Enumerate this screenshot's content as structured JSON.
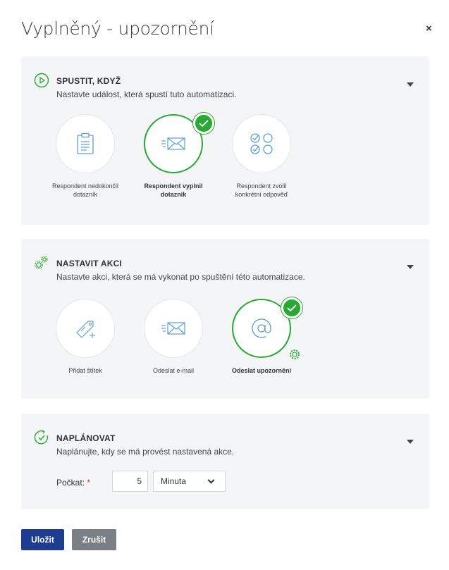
{
  "dialog": {
    "title": "Vyplněný - upozornění",
    "close": "×"
  },
  "trigger": {
    "title": "SPUSTIT, KDYŽ",
    "description": "Nastavte událost, která spustí tuto automatizaci.",
    "options": [
      {
        "label": "Respondent nedokončil dotazník",
        "icon": "clipboard-icon",
        "selected": false
      },
      {
        "label": "Respondent vyplnil dotazník",
        "icon": "envelope-send-icon",
        "selected": true
      },
      {
        "label": "Respondent zvolil konkrétní odpověď",
        "icon": "choice-options-icon",
        "selected": false
      }
    ]
  },
  "action": {
    "title": "NASTAVIT AKCI",
    "description": "Nastavte akci, která se má vykonat po spuštění této automatizace.",
    "options": [
      {
        "label": "Přidat štítek",
        "icon": "tag-add-icon",
        "selected": false
      },
      {
        "label": "Odeslat e-mail",
        "icon": "envelope-send-icon",
        "selected": false
      },
      {
        "label": "Odeslat upozornění",
        "icon": "at-sign-icon",
        "selected": true
      }
    ]
  },
  "schedule": {
    "title": "NAPLÁNOVAT",
    "description": "Naplánujte, kdy se má provést nastavená akce.",
    "wait_label": "Počkat:",
    "required_mark": "*",
    "wait_value": "5",
    "unit_selected": "Minuta"
  },
  "buttons": {
    "save": "Uložit",
    "cancel": "Zrušit"
  },
  "colors": {
    "accent_green": "#2aa836",
    "primary_blue": "#1d3c8f",
    "secondary_gray": "#7a7f85",
    "icon_blue": "#5a9fd4",
    "panel_bg": "#f4f5f6"
  }
}
